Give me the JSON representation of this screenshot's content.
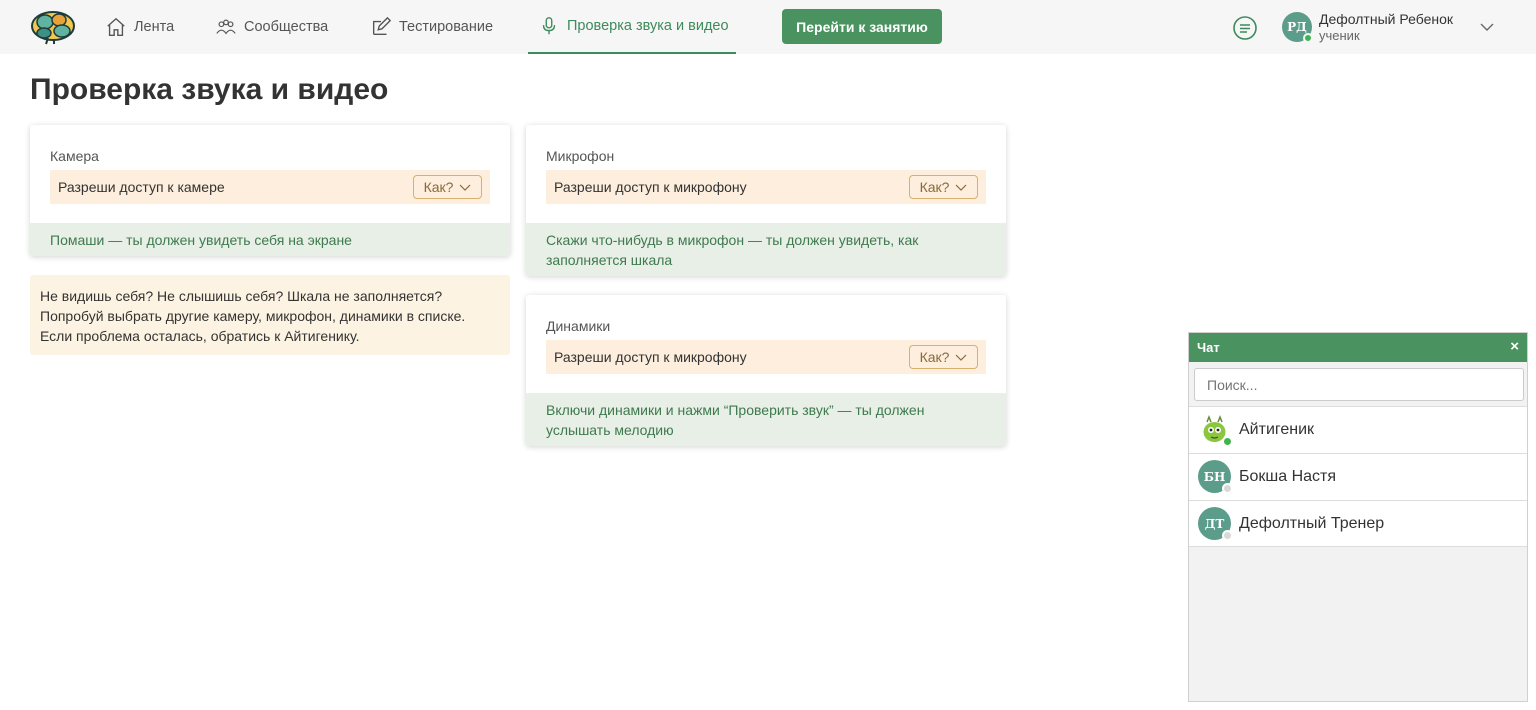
{
  "nav": {
    "items": [
      {
        "label": "Лента",
        "icon": "home-icon"
      },
      {
        "label": "Сообщества",
        "icon": "people-icon"
      },
      {
        "label": "Тестирование",
        "icon": "edit-icon"
      },
      {
        "label": "Проверка звука и видео",
        "icon": "microphone-icon",
        "active": true
      }
    ],
    "go_button": "Перейти к занятию",
    "user": {
      "initials": "РД",
      "name": "Дефолтный Ребенок",
      "role": "ученик",
      "status": "online"
    }
  },
  "page": {
    "title": "Проверка звука и видео"
  },
  "cards": {
    "camera": {
      "label": "Камера",
      "permission": "Разреши доступ к камере",
      "how": "Как?",
      "hint": "Помаши — ты должен увидеть себя на экране"
    },
    "microphone": {
      "label": "Микрофон",
      "permission": "Разреши доступ к микрофону",
      "how": "Как?",
      "hint": "Скажи что-нибудь в микрофон — ты должен увидеть, как заполняется шкала"
    },
    "speakers": {
      "label": "Динамики",
      "permission": "Разреши доступ к микрофону",
      "how": "Как?",
      "hint": "Включи динамики и нажми “Проверить звук” — ты должен услышать мелодию"
    }
  },
  "notice": {
    "line1": "Не видишь себя? Не слышишь себя? Шкала не заполняется?",
    "line2": "Попробуй выбрать другие камеру, микрофон, динамики в списке.",
    "line3": "Если проблема осталась, обратись к Айтигенику."
  },
  "chat": {
    "title": "Чат",
    "close": "×",
    "search_placeholder": "Поиск...",
    "contacts": [
      {
        "name": "Айтигеник",
        "initials": "",
        "status": "online",
        "avatar": "mascot-icon"
      },
      {
        "name": "Бокша Настя",
        "initials": "БН",
        "status": "offline"
      },
      {
        "name": "Дефолтный Тренер",
        "initials": "ДТ",
        "status": "offline"
      }
    ]
  },
  "colors": {
    "accent": "#4a9360",
    "warning_bg": "#fdeedd",
    "hint_bg": "#e7efe7",
    "online": "#3fb44e",
    "avatar": "#5c9c8a"
  }
}
